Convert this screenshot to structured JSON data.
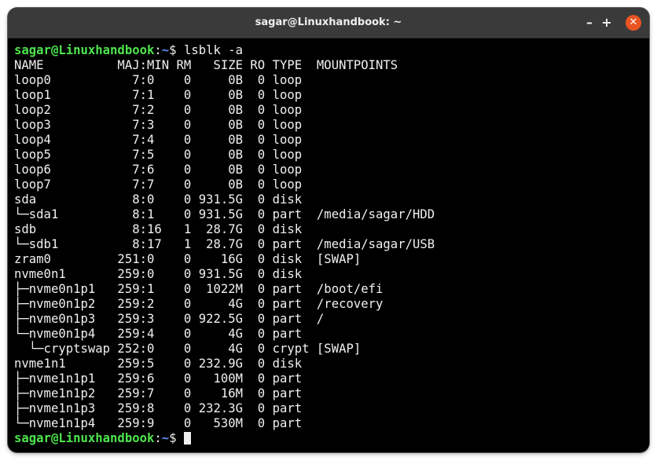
{
  "window": {
    "title": "sagar@Linuxhandbook: ~",
    "minimize_glyph": "–",
    "maximize_glyph": "+",
    "close_glyph": "✕"
  },
  "prompt": {
    "user_host": "sagar@Linuxhandbook",
    "separator": ":",
    "path": "~",
    "symbol": "$ "
  },
  "command": "lsblk -a",
  "output": [
    "NAME          MAJ:MIN RM   SIZE RO TYPE  MOUNTPOINTS",
    "loop0           7:0    0     0B  0 loop",
    "loop1           7:1    0     0B  0 loop",
    "loop2           7:2    0     0B  0 loop",
    "loop3           7:3    0     0B  0 loop",
    "loop4           7:4    0     0B  0 loop",
    "loop5           7:5    0     0B  0 loop",
    "loop6           7:6    0     0B  0 loop",
    "loop7           7:7    0     0B  0 loop",
    "sda             8:0    0 931.5G  0 disk",
    "└─sda1          8:1    0 931.5G  0 part  /media/sagar/HDD",
    "sdb             8:16   1  28.7G  0 disk",
    "└─sdb1          8:17   1  28.7G  0 part  /media/sagar/USB",
    "zram0         251:0    0    16G  0 disk  [SWAP]",
    "nvme0n1       259:0    0 931.5G  0 disk",
    "├─nvme0n1p1   259:1    0  1022M  0 part  /boot/efi",
    "├─nvme0n1p2   259:2    0     4G  0 part  /recovery",
    "├─nvme0n1p3   259:3    0 922.5G  0 part  /",
    "└─nvme0n1p4   259:4    0     4G  0 part",
    "  └─cryptswap 252:0    0     4G  0 crypt [SWAP]",
    "nvme1n1       259:5    0 232.9G  0 disk",
    "├─nvme1n1p1   259:6    0   100M  0 part",
    "├─nvme1n1p2   259:7    0    16M  0 part",
    "├─nvme1n1p3   259:8    0 232.3G  0 part",
    "└─nvme1n1p4   259:9    0   530M  0 part"
  ],
  "colors": {
    "background": "#000000",
    "text": "#f0f0f0",
    "prompt_user": "#4ee44e",
    "prompt_path": "#5c8cf5",
    "titlebar": "#3a3a3a",
    "close_button": "#e95420"
  }
}
